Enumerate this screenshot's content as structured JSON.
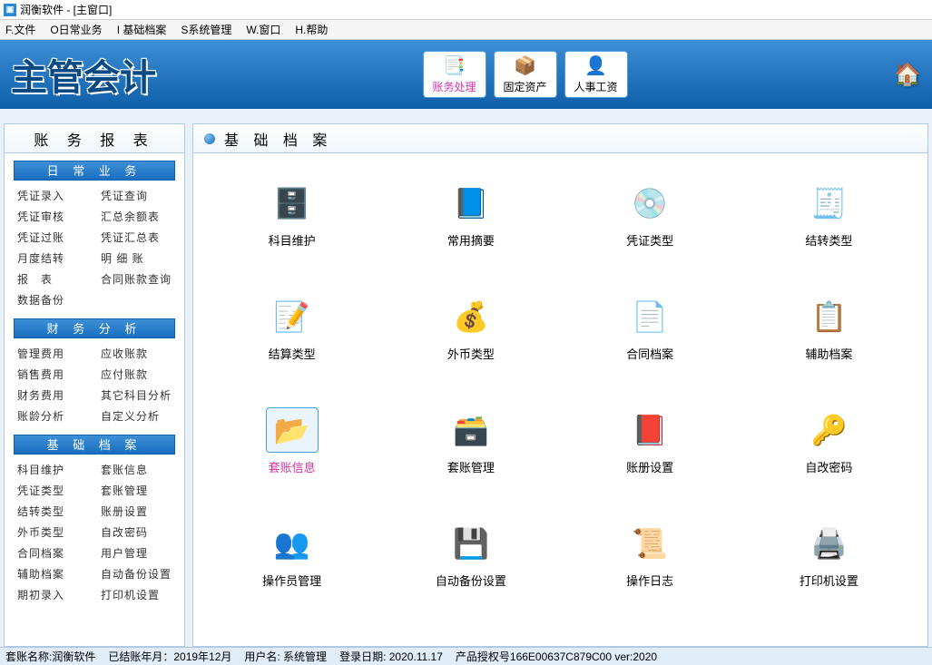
{
  "window": {
    "title": "润衡软件 - [主窗口]"
  },
  "menus": [
    {
      "label": "F.文件"
    },
    {
      "label": "O日常业务"
    },
    {
      "label": "I 基础档案"
    },
    {
      "label": "S系统管理"
    },
    {
      "label": "W.窗口"
    },
    {
      "label": "H.帮助"
    }
  ],
  "banner": {
    "logo": "主管会计",
    "buttons": [
      {
        "label": "账务处理",
        "icon": "📑",
        "accent": true
      },
      {
        "label": "固定资产",
        "icon": "📦"
      },
      {
        "label": "人事工资",
        "icon": "👤"
      }
    ],
    "tax_icon": "🏠"
  },
  "sidebar": {
    "title": "账 务 报 表",
    "sections": [
      {
        "header": "日 常 业 务",
        "links": [
          "凭证录入",
          "凭证查询",
          "凭证审核",
          "汇总余额表",
          "凭证过账",
          "凭证汇总表",
          "月度结转",
          "明 细 账",
          "报　表",
          "合同账款查询",
          "数据备份",
          ""
        ]
      },
      {
        "header": "财 务 分 析",
        "links": [
          "管理费用",
          "应收账款",
          "销售费用",
          "应付账款",
          "财务费用",
          "其它科目分析",
          "账龄分析",
          "自定义分析"
        ]
      },
      {
        "header": "基 础 档 案",
        "links": [
          "科目维护",
          "套账信息",
          "凭证类型",
          "套账管理",
          "结转类型",
          "账册设置",
          "外币类型",
          "自改密码",
          "合同档案",
          "用户管理",
          "辅助档案",
          "自动备份设置",
          "期初录入",
          "打印机设置"
        ]
      }
    ]
  },
  "main": {
    "title": "基 础 档 案",
    "items": [
      {
        "label": "科目维护",
        "icon": "🗄️",
        "name": "subject-maint"
      },
      {
        "label": "常用摘要",
        "icon": "📘",
        "name": "common-abstract"
      },
      {
        "label": "凭证类型",
        "icon": "💿",
        "name": "voucher-type"
      },
      {
        "label": "结转类型",
        "icon": "🧾",
        "name": "carryover-type"
      },
      {
        "label": "结算类型",
        "icon": "📝",
        "name": "settle-type"
      },
      {
        "label": "外币类型",
        "icon": "💰",
        "name": "currency-type"
      },
      {
        "label": "合同档案",
        "icon": "📄",
        "name": "contract-archive"
      },
      {
        "label": "辅助档案",
        "icon": "📋",
        "name": "aux-archive"
      },
      {
        "label": "套账信息",
        "icon": "📂",
        "name": "account-info",
        "selected": true
      },
      {
        "label": "套账管理",
        "icon": "🗃️",
        "name": "account-manage"
      },
      {
        "label": "账册设置",
        "icon": "📕",
        "name": "book-setting"
      },
      {
        "label": "自改密码",
        "icon": "🔑",
        "name": "change-password"
      },
      {
        "label": "操作员管理",
        "icon": "👥",
        "name": "operator-manage"
      },
      {
        "label": "自动备份设置",
        "icon": "💾",
        "name": "auto-backup"
      },
      {
        "label": "操作日志",
        "icon": "📜",
        "name": "operation-log"
      },
      {
        "label": "打印机设置",
        "icon": "🖨️",
        "name": "printer-setting"
      }
    ]
  },
  "status": {
    "s1": "套账名称:润衡软件",
    "s2": "已结账年月：2019年12月",
    "s3": "用户名: 系统管理",
    "s4": "登录日期: 2020.11.17",
    "s5": "产品授权号166E00637C879C00  ver:2020"
  }
}
